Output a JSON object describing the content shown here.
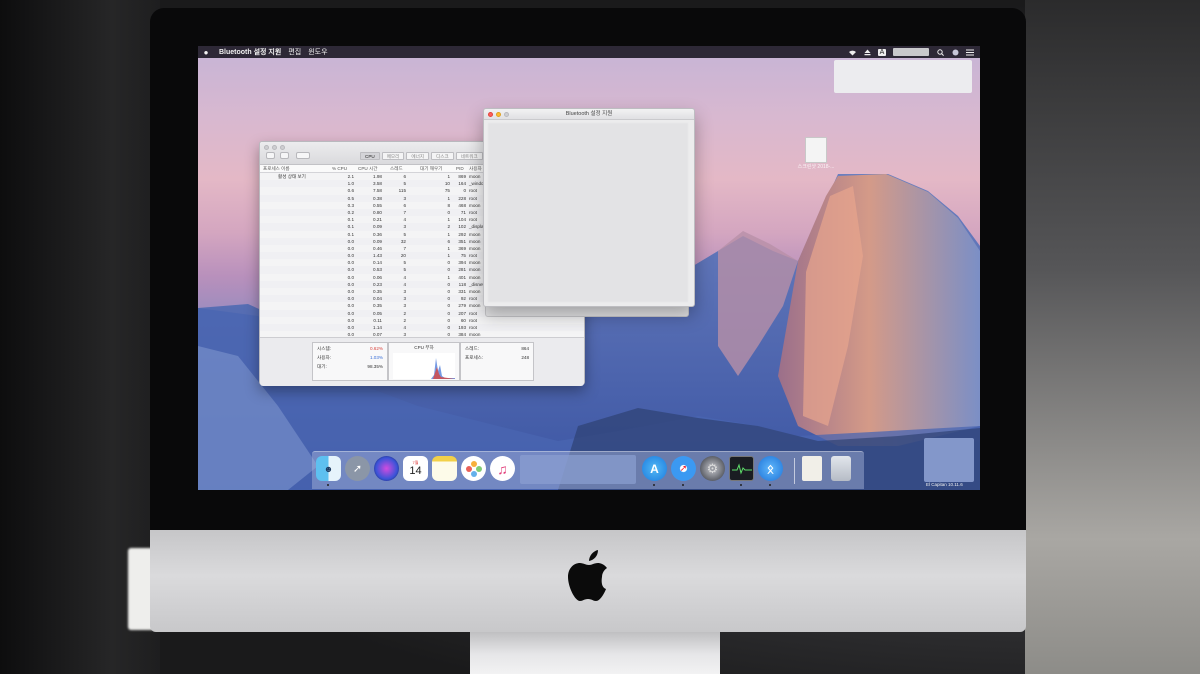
{
  "menubar": {
    "apple": "",
    "app_name": "Bluetooth 설정 지원",
    "items": [
      "편집",
      "윈도우"
    ]
  },
  "status_icons": [
    "wifi-icon",
    "eject-icon",
    "input-menu-icon",
    "search-icon",
    "siri-icon",
    "notification-center-icon"
  ],
  "status_input_label": "A",
  "desktop": {
    "icon_label": "스크린샷 2018-..."
  },
  "activity_monitor": {
    "tabs": [
      "CPU",
      "메모리",
      "에너지",
      "디스크",
      "네트워크"
    ],
    "active_tab": "CPU",
    "columns": {
      "name": "프로세스 이름",
      "cpu": "% CPU",
      "time": "CPU 시간",
      "threads": "스레드",
      "idle": "대기 깨우기",
      "pid": "PID",
      "user": "사용자"
    },
    "rows": [
      {
        "name": "활성 상태 보기",
        "cpu": "2.1",
        "time": "1.98",
        "threads": "6",
        "idle": "1",
        "pid": "869",
        "user": "moon"
      },
      {
        "name": "",
        "cpu": "1.0",
        "time": "3.58",
        "threads": "5",
        "idle": "10",
        "pid": "164",
        "user": "_windo"
      },
      {
        "name": "",
        "cpu": "0.6",
        "time": "7.58",
        "threads": "115",
        "idle": "75",
        "pid": "0",
        "user": "root"
      },
      {
        "name": "",
        "cpu": "0.5",
        "time": "0.38",
        "threads": "3",
        "idle": "1",
        "pid": "228",
        "user": "root"
      },
      {
        "name": "",
        "cpu": "0.3",
        "time": "0.55",
        "threads": "6",
        "idle": "8",
        "pid": "468",
        "user": "moon"
      },
      {
        "name": "",
        "cpu": "0.2",
        "time": "0.80",
        "threads": "7",
        "idle": "0",
        "pid": "71",
        "user": "root"
      },
      {
        "name": "",
        "cpu": "0.1",
        "time": "0.21",
        "threads": "4",
        "idle": "1",
        "pid": "104",
        "user": "root"
      },
      {
        "name": "",
        "cpu": "0.1",
        "time": "0.09",
        "threads": "3",
        "idle": "2",
        "pid": "102",
        "user": "_displa"
      },
      {
        "name": "",
        "cpu": "0.1",
        "time": "0.36",
        "threads": "5",
        "idle": "1",
        "pid": "292",
        "user": "moon"
      },
      {
        "name": "",
        "cpu": "0.0",
        "time": "0.09",
        "threads": "32",
        "idle": "6",
        "pid": "351",
        "user": "moon"
      },
      {
        "name": "",
        "cpu": "0.0",
        "time": "0.46",
        "threads": "7",
        "idle": "1",
        "pid": "369",
        "user": "moon"
      },
      {
        "name": "",
        "cpu": "0.0",
        "time": "1.43",
        "threads": "20",
        "idle": "1",
        "pid": "75",
        "user": "root"
      },
      {
        "name": "",
        "cpu": "0.0",
        "time": "0.14",
        "threads": "5",
        "idle": "0",
        "pid": "394",
        "user": "moon"
      },
      {
        "name": "",
        "cpu": "0.0",
        "time": "0.53",
        "threads": "5",
        "idle": "0",
        "pid": "281",
        "user": "moon"
      },
      {
        "name": "",
        "cpu": "0.0",
        "time": "0.06",
        "threads": "4",
        "idle": "1",
        "pid": "401",
        "user": "moon"
      },
      {
        "name": "",
        "cpu": "0.0",
        "time": "0.23",
        "threads": "4",
        "idle": "0",
        "pid": "118",
        "user": "_disnet"
      },
      {
        "name": "",
        "cpu": "0.0",
        "time": "0.35",
        "threads": "3",
        "idle": "0",
        "pid": "331",
        "user": "moon"
      },
      {
        "name": "",
        "cpu": "0.0",
        "time": "0.04",
        "threads": "3",
        "idle": "0",
        "pid": "92",
        "user": "root"
      },
      {
        "name": "",
        "cpu": "0.0",
        "time": "0.35",
        "threads": "3",
        "idle": "0",
        "pid": "279",
        "user": "moon"
      },
      {
        "name": "",
        "cpu": "0.0",
        "time": "0.05",
        "threads": "2",
        "idle": "0",
        "pid": "207",
        "user": "root"
      },
      {
        "name": "",
        "cpu": "0.0",
        "time": "0.11",
        "threads": "2",
        "idle": "0",
        "pid": "60",
        "user": "root"
      },
      {
        "name": "",
        "cpu": "0.0",
        "time": "1.14",
        "threads": "4",
        "idle": "0",
        "pid": "193",
        "user": "root"
      },
      {
        "name": "",
        "cpu": "0.0",
        "time": "0.07",
        "threads": "3",
        "idle": "0",
        "pid": "384",
        "user": "moon"
      }
    ],
    "summary": {
      "system_label": "시스템:",
      "system_value": "0.62%",
      "user_label": "사용자:",
      "user_value": "1.03%",
      "idle_label": "대기:",
      "idle_value": "98.35%",
      "load_label": "CPU 부하",
      "threads_label": "스레드:",
      "threads_value": "864",
      "processes_label": "프로세스:",
      "processes_value": "248"
    },
    "colors": {
      "system": "#d9453f",
      "user": "#3b6fd8"
    }
  },
  "bluetooth_window": {
    "title": "Bluetooth 설정 지원"
  },
  "dock": {
    "apps": [
      {
        "name": "finder-icon"
      },
      {
        "name": "launchpad-icon"
      },
      {
        "name": "siri-icon"
      },
      {
        "name": "calendar-icon",
        "month": "7월",
        "day": "14"
      },
      {
        "name": "notes-icon"
      },
      {
        "name": "photos-icon"
      },
      {
        "name": "itunes-icon"
      },
      {
        "name": "app-store-icon"
      },
      {
        "name": "safari-icon"
      },
      {
        "name": "system-preferences-icon"
      },
      {
        "name": "activity-monitor-icon"
      },
      {
        "name": "bluetooth-icon"
      },
      {
        "name": "documents-icon"
      },
      {
        "name": "trash-icon"
      }
    ]
  },
  "corner_text": "El Capitan 10.11.6"
}
